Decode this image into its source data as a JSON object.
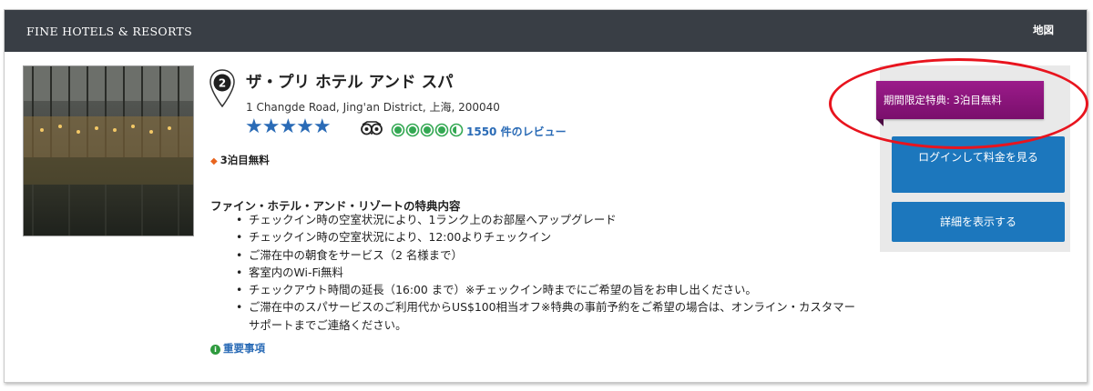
{
  "header": {
    "brand": "FINE HOTELS & RESORTS",
    "map_link": "地図"
  },
  "hotel": {
    "rank": "2",
    "name": "ザ・プリ ホテル アンド スパ",
    "address": "1 Changde Road, Jing'an District, 上海, 200040",
    "stars": "★★★★★",
    "star_rating": 5,
    "tripadvisor_rating": 4.5,
    "reviews": "1550 件のレビュー",
    "offer_tag": "3泊目無料"
  },
  "benefits": {
    "title": "ファイン・ホテル・アンド・リゾートの特典内容",
    "items": [
      "チェックイン時の空室状況により、1ランク上のお部屋へアップグレード",
      "チェックイン時の空室状況により、12:00よりチェックイン",
      "ご滞在中の朝食をサービス（2 名様まで）",
      "客室内のWi-Fi無料",
      "チェックアウト時間の延長（16:00 まで）※チェックイン時までにご希望の旨をお申し出ください。",
      "ご滞在中のスパサービスのご利用代からUS$100相当オフ※特典の事前予約をご希望の場合は、オンライン・カスタマーサポートまでご連絡ください。"
    ]
  },
  "important_link": "重要事項",
  "sidebar": {
    "promo": "期間限定特典: 3泊目無料",
    "login_button": "ログインして料金を見る",
    "details_button": "詳細を表示する"
  },
  "colors": {
    "header_bg": "#393e45",
    "accent_blue": "#1c77bd",
    "promo_purple": "#8e1580",
    "tripadvisor_green": "#34a853",
    "highlight_circle": "#e8141e",
    "tag_orange": "#e8641e"
  },
  "icons": [
    "map-pin-icon",
    "tripadvisor-owl-icon",
    "tag-icon",
    "info-icon"
  ]
}
